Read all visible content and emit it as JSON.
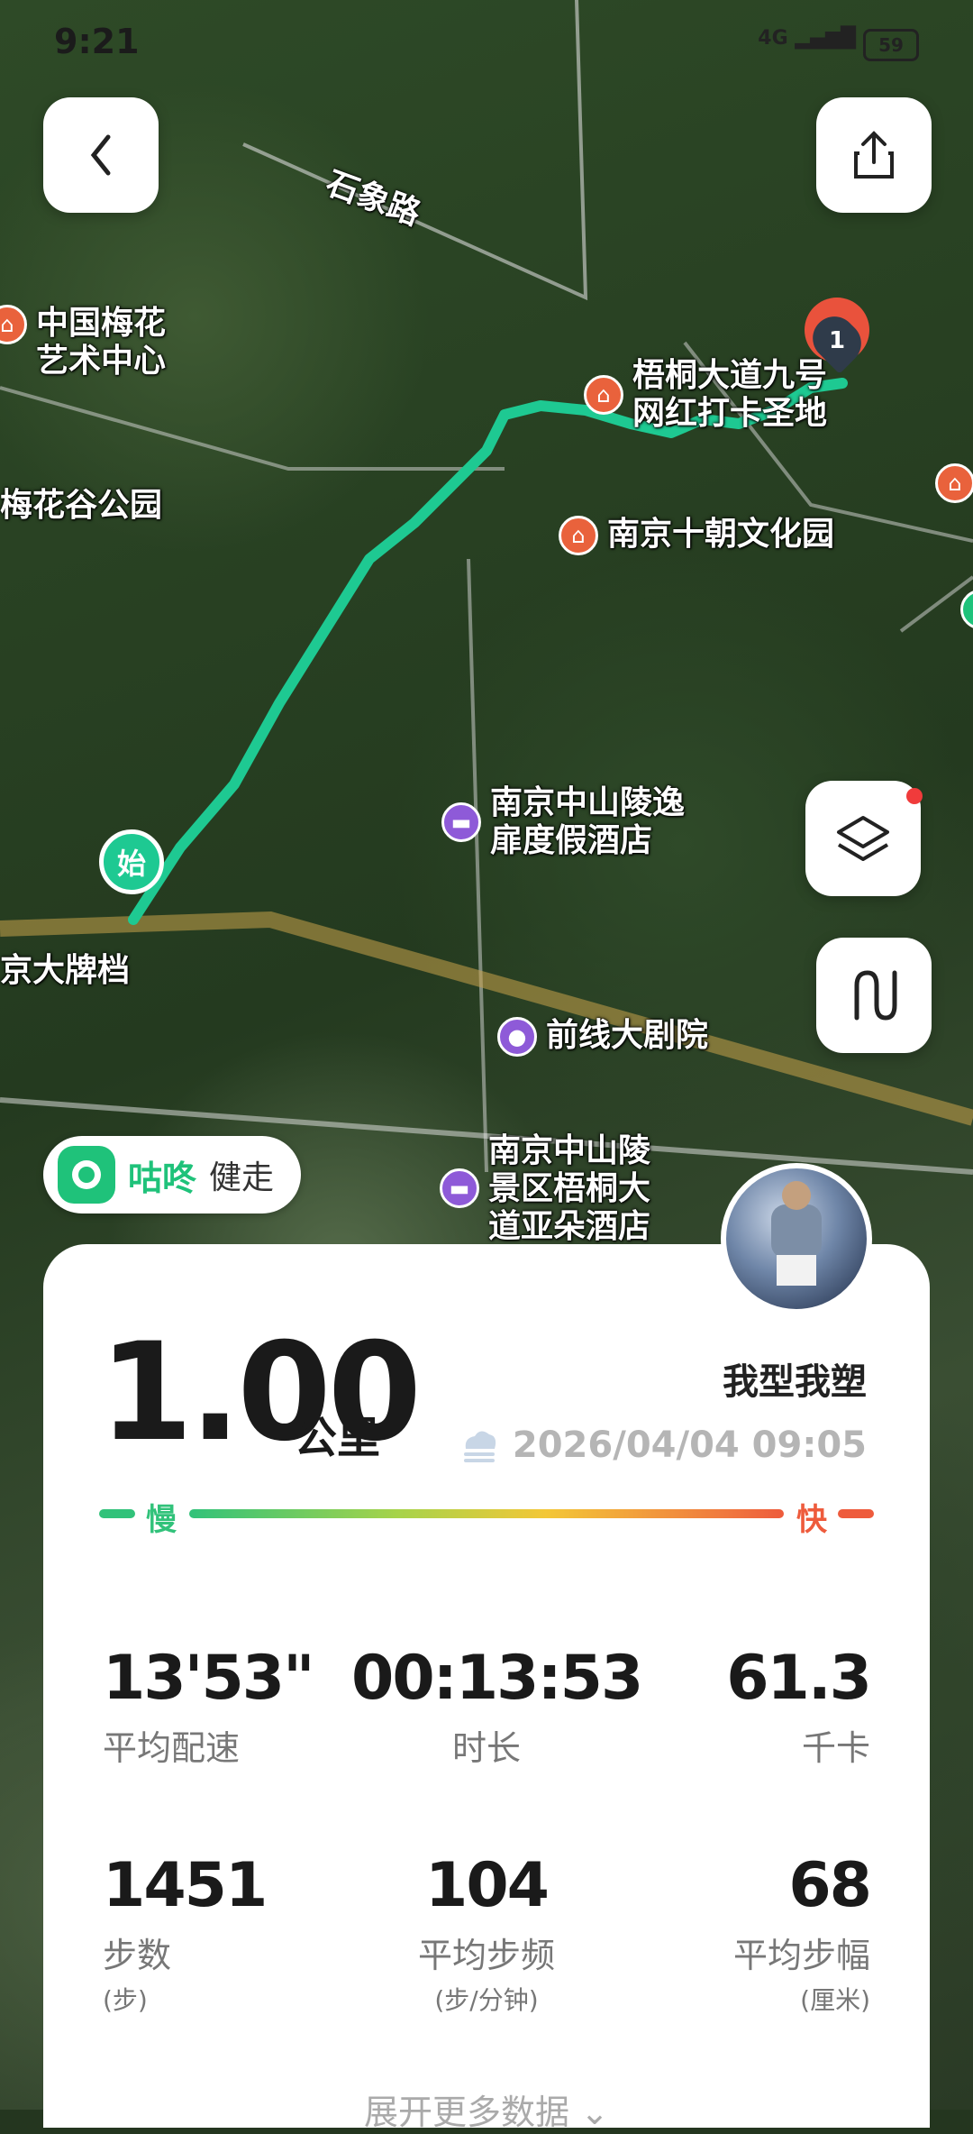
{
  "status_bar": {
    "time": "9:21",
    "network": "4G",
    "battery": "59"
  },
  "map": {
    "labels": {
      "road_shixiang": "石象路",
      "poi_meihua": [
        "中国梅花",
        "艺术中心"
      ],
      "poi_meihuagu": "梅花谷公园",
      "poi_wutong": [
        "梧桐大道九号",
        "网红打卡圣地"
      ],
      "poi_shichao": "南京十朝文化园",
      "poi_hotel1": [
        "南京中山陵逸",
        "扉度假酒店"
      ],
      "poi_theatre": "前线大剧院",
      "poi_hotel2": [
        "南京中山陵",
        "景区梧桐大",
        "道亚朵酒店"
      ],
      "poi_dapaidang": "京大牌档",
      "start_marker": "始",
      "end_marker": "1"
    },
    "route_color": "#1ec992"
  },
  "buttons": {
    "back": "back-icon",
    "share": "share-icon",
    "layers": "layers-icon",
    "route": "route-icon"
  },
  "badge": {
    "brand": "咕咚",
    "sub": "健走"
  },
  "summary": {
    "distance": "1.00",
    "distance_unit": "公里",
    "mode": "我型我塑",
    "datetime": "2026/04/04 09:05",
    "slow": "慢",
    "fast": "快"
  },
  "stats": [
    {
      "value": "13'53\"",
      "label": "平均配速",
      "unit": ""
    },
    {
      "value": "00:13:53",
      "label": "时长",
      "unit": ""
    },
    {
      "value": "61.3",
      "label": "千卡",
      "unit": ""
    },
    {
      "value": "1451",
      "label": "步数",
      "unit": "(步)"
    },
    {
      "value": "104",
      "label": "平均步频",
      "unit": "(步/分钟)"
    },
    {
      "value": "68",
      "label": "平均步幅",
      "unit": "(厘米)"
    }
  ],
  "more": "展开更多数据"
}
